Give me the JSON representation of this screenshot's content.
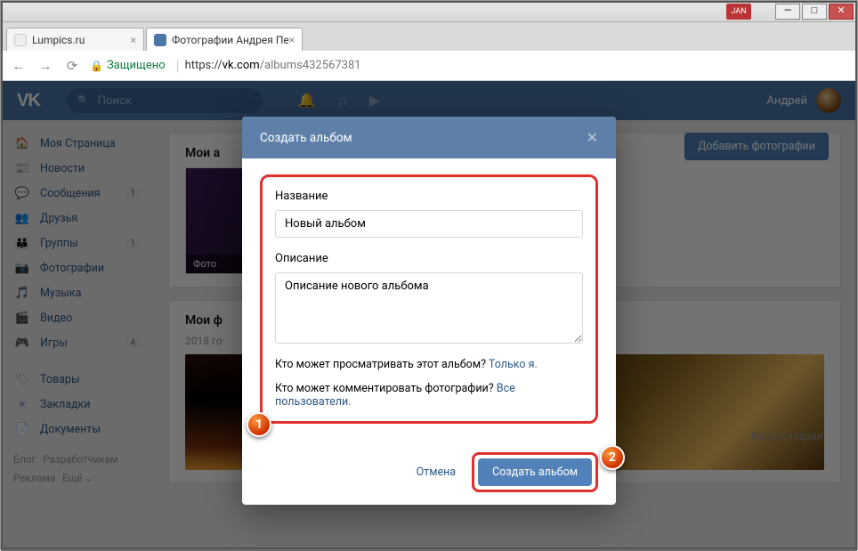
{
  "window": {
    "ext_badge": "JAN"
  },
  "tabs": [
    {
      "title": "Lumpics.ru"
    },
    {
      "title": "Фотографии Андрея Пе"
    }
  ],
  "urlbar": {
    "secure_label": "Защищено",
    "proto": "https://",
    "domain": "vk.com",
    "path": "/albums432567381"
  },
  "vk": {
    "search_placeholder": "Поиск",
    "username": "Андрей"
  },
  "sidebar": {
    "items": [
      {
        "icon": "🏠",
        "label": "Моя Страница",
        "badge": ""
      },
      {
        "icon": "📰",
        "label": "Новости",
        "badge": ""
      },
      {
        "icon": "💬",
        "label": "Сообщения",
        "badge": "1"
      },
      {
        "icon": "👥",
        "label": "Друзья",
        "badge": ""
      },
      {
        "icon": "👪",
        "label": "Группы",
        "badge": "1"
      },
      {
        "icon": "📷",
        "label": "Фотографии",
        "badge": ""
      },
      {
        "icon": "🎵",
        "label": "Музыка",
        "badge": ""
      },
      {
        "icon": "🎬",
        "label": "Видео",
        "badge": ""
      },
      {
        "icon": "🎮",
        "label": "Игры",
        "badge": "4"
      }
    ],
    "items2": [
      {
        "icon": "🏷",
        "label": "Товары"
      },
      {
        "icon": "★",
        "label": "Закладки"
      },
      {
        "icon": "📄",
        "label": "Документы"
      }
    ],
    "footer": [
      "Блог",
      "Разработчикам",
      "Реклама",
      "Ещё ⌄"
    ]
  },
  "main": {
    "block1_title": "Мои а",
    "add_photos": "Добавить фотографии",
    "album_caption": "Фото",
    "block2_title": "Мои ф",
    "comments": "Комментарии",
    "year": "2018 го"
  },
  "modal": {
    "title": "Создать альбом",
    "name_label": "Название",
    "name_value": "Новый альбом",
    "desc_label": "Описание",
    "desc_value": "Описание нового альбома",
    "priv_view_q": "Кто может просматривать этот альбом? ",
    "priv_view_a": "Только я.",
    "priv_comment_q": "Кто может комментировать фотографии? ",
    "priv_comment_a": "Все пользователи.",
    "cancel": "Отмена",
    "create": "Создать альбом"
  },
  "markers": {
    "m1": "1",
    "m2": "2"
  }
}
